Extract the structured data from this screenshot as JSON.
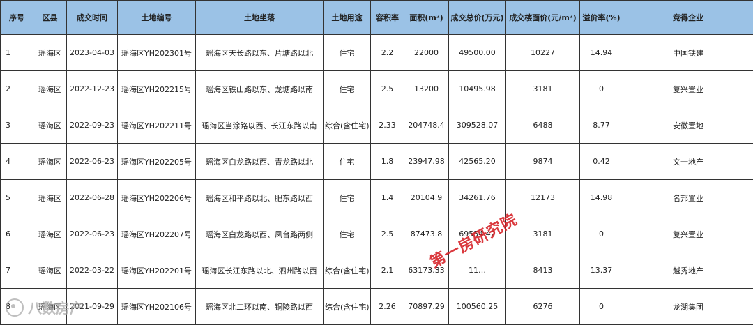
{
  "headers": [
    "序号",
    "区县",
    "成交时间",
    "土地编号",
    "土地坐落",
    "土地用途",
    "容积率",
    "面积(m²)",
    "成交总价(万元)",
    "成交楼面价(元/m²)",
    "溢价率(%)",
    "竞得企业"
  ],
  "rows": [
    [
      "1",
      "瑶海区",
      "2023-04-03",
      "瑶海区YH202301号",
      "瑶海区天长路以东、片塘路以北",
      "住宅",
      "2.2",
      "22000",
      "49500.00",
      "10227",
      "14.94",
      "中国铁建"
    ],
    [
      "2",
      "瑶海区",
      "2022-12-23",
      "瑶海区YH202215号",
      "瑶海区铁山路以东、龙塘路以南",
      "住宅",
      "2.5",
      "13200",
      "10495.98",
      "3181",
      "0",
      "复兴置业"
    ],
    [
      "3",
      "瑶海区",
      "2022-09-23",
      "瑶海区YH202211号",
      "瑶海区当涂路以西、长江东路以南",
      "综合(含住宅)",
      "2.33",
      "204748.4",
      "309528.07",
      "6488",
      "8.77",
      "安徽置地"
    ],
    [
      "4",
      "瑶海区",
      "2022-06-23",
      "瑶海区YH202205号",
      "瑶海区白龙路以西、青龙路以北",
      "住宅",
      "1.8",
      "23947.98",
      "42565.20",
      "9874",
      "0.42",
      "文一地产"
    ],
    [
      "5",
      "瑶海区",
      "2022-06-28",
      "瑶海区YH202206号",
      "瑶海区和平路以北、肥东路以西",
      "住宅",
      "1.4",
      "20104.9",
      "34261.76",
      "12173",
      "14.98",
      "名邦置业"
    ],
    [
      "6",
      "瑶海区",
      "2022-06-23",
      "瑶海区YH202207号",
      "瑶海区白龙路以西、凤台路两侧",
      "住宅",
      "2.5",
      "87473.8",
      "69554.42",
      "3181",
      "0",
      "复兴置业"
    ],
    [
      "7",
      "瑶海区",
      "2022-03-22",
      "瑶海区YH202201号",
      "瑶海区长江东路以北、泗州路以西",
      "综合(含住宅)",
      "2.1",
      "63173.33",
      "11…",
      "8413",
      "13.37",
      "越秀地产"
    ],
    [
      "8",
      "瑶海区",
      "2021-09-29",
      "瑶海区YH202106号",
      "瑶海区北二环以南、铜陵路以西",
      "综合(含住宅)",
      "2.26",
      "70897.29",
      "100560.25",
      "6276",
      "0",
      "龙湖集团"
    ]
  ],
  "watermark": {
    "red_text": "第一房研究院",
    "logo_text": "八数房产"
  }
}
